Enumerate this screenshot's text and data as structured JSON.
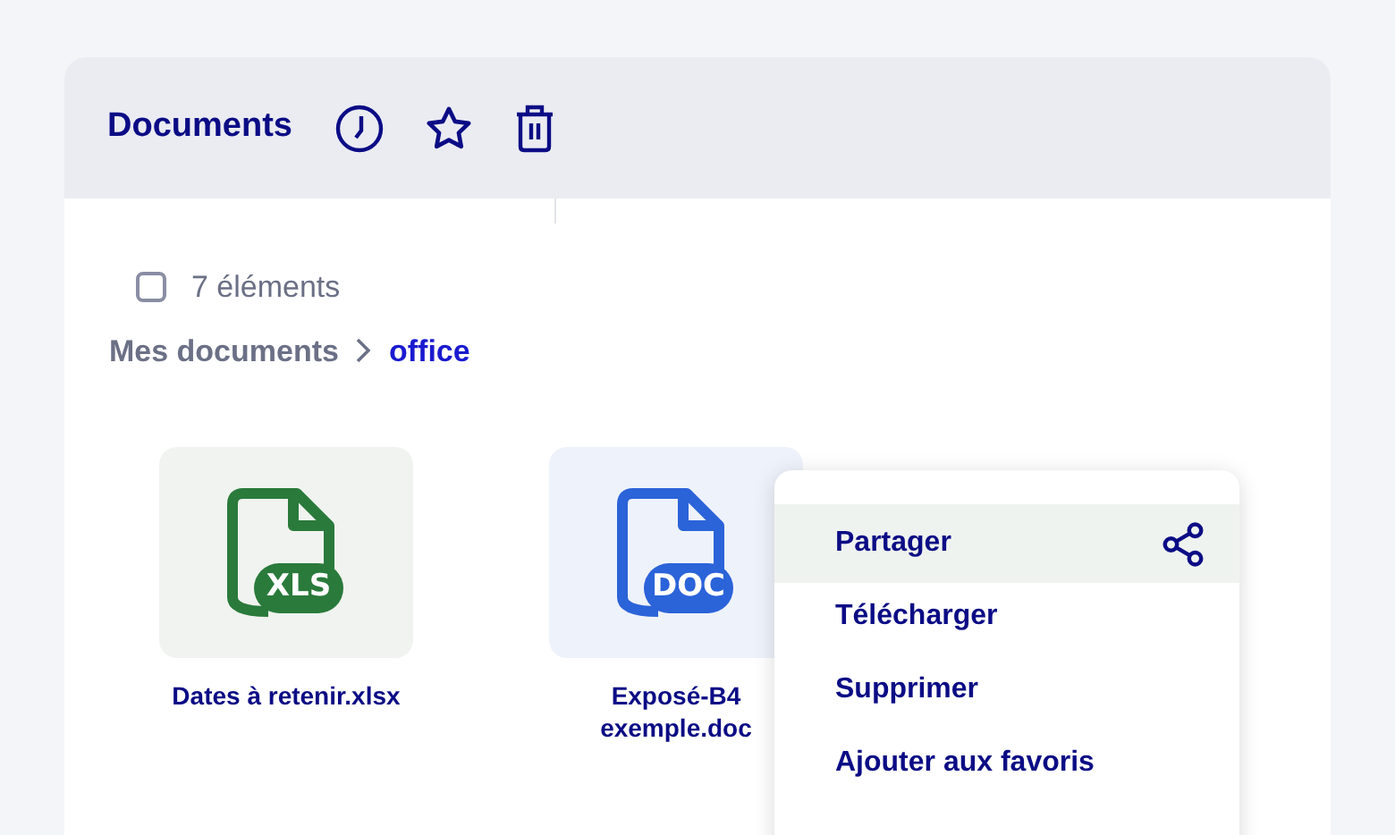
{
  "header": {
    "title": "Documents"
  },
  "selection": {
    "checked": false,
    "count": "7 éléments"
  },
  "breadcrumb": [
    {
      "label": "Mes documents",
      "current": false
    },
    {
      "label": "office",
      "current": true
    }
  ],
  "files": [
    {
      "name": "Dates à retenir.xlsx",
      "kind": "xls",
      "badge": "XLS"
    },
    {
      "name": "Exposé-B4 exemple.doc",
      "kind": "doc",
      "badge": "DOC"
    }
  ],
  "context_menu": [
    {
      "label": "Partager",
      "selected": true
    },
    {
      "label": "Télécharger",
      "selected": false
    },
    {
      "label": "Supprimer",
      "selected": false
    },
    {
      "label": "Ajouter aux favoris",
      "selected": false
    }
  ]
}
